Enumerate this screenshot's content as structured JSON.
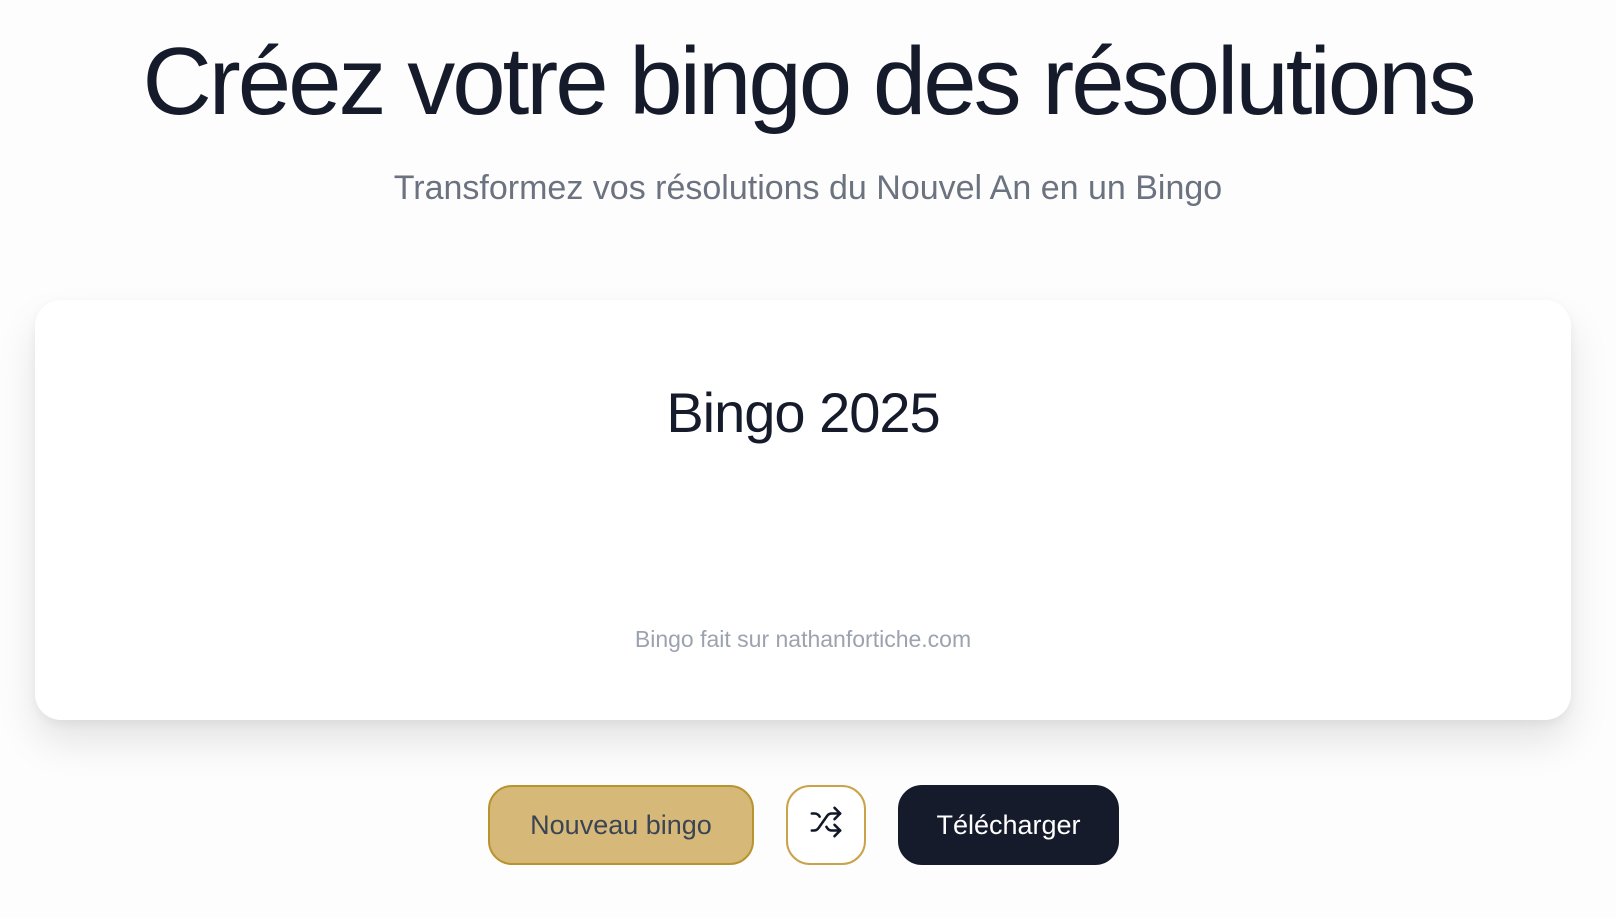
{
  "header": {
    "title": "Créez votre bingo des résolutions",
    "subtitle": "Transformez vos résolutions du Nouvel An en un Bingo"
  },
  "card": {
    "title": "Bingo 2025",
    "footer": "Bingo fait sur nathanfortiche.com"
  },
  "actions": {
    "new_label": "Nouveau bingo",
    "shuffle_icon": "shuffle-icon",
    "download_label": "Télécharger"
  },
  "colors": {
    "accent": "#d6b979",
    "accent_border": "#b8942f",
    "dark": "#151b2b",
    "muted": "#6b7280"
  }
}
